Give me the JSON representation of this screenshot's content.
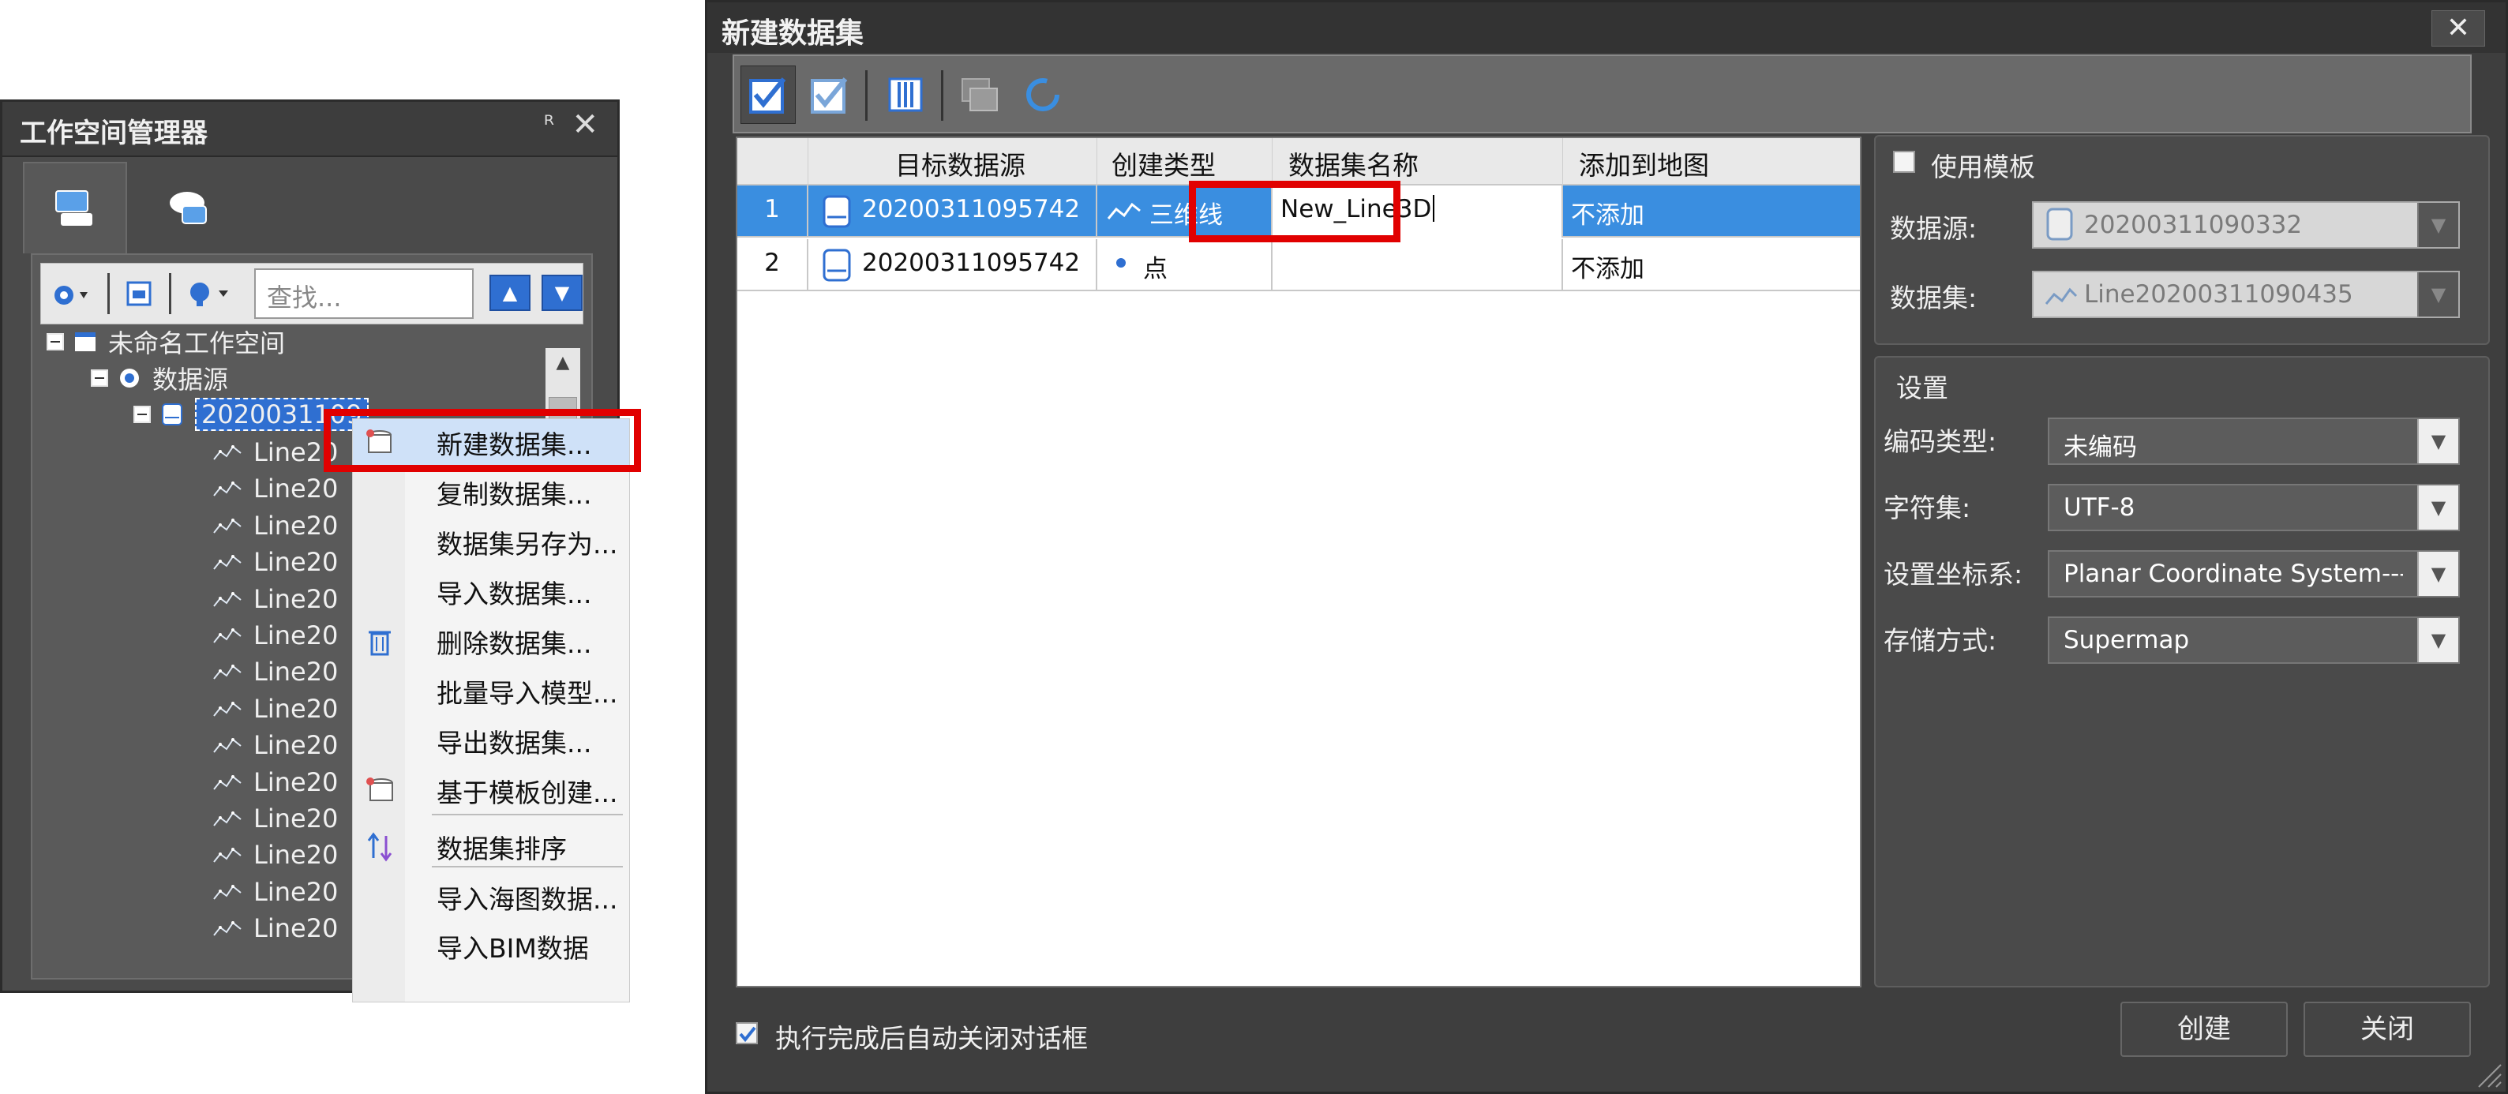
{
  "workspace_panel": {
    "title": "工作空间管理器",
    "pin_glyph": "ᴿ",
    "close_glyph": "✕",
    "search_placeholder": "查找...",
    "tree": {
      "workspace": "未命名工作空间",
      "datasources": "数据源",
      "datasource": "2020031109",
      "datasets": [
        "Line20",
        "Line20",
        "Line20",
        "Line20",
        "Line20",
        "Line20",
        "Line20",
        "Line20",
        "Line20",
        "Line20",
        "Line20",
        "Line20",
        "Line20",
        "Line20"
      ]
    }
  },
  "context_menu": {
    "items": [
      {
        "label": "新建数据集...",
        "icon": "new-dataset-icon",
        "highlighted": true
      },
      {
        "label": "复制数据集...",
        "icon": ""
      },
      {
        "label": "数据集另存为...",
        "icon": ""
      },
      {
        "label": "导入数据集...",
        "icon": ""
      },
      {
        "label": "删除数据集...",
        "icon": "trash-icon"
      },
      {
        "label": "批量导入模型...",
        "icon": ""
      },
      {
        "label": "导出数据集...",
        "icon": ""
      },
      {
        "label": "基于模板创建...",
        "icon": "template-dataset-icon"
      },
      {
        "label": "数据集排序",
        "icon": "sort-icon"
      },
      {
        "label": "导入海图数据...",
        "icon": ""
      },
      {
        "label": "导入BIM数据",
        "icon": ""
      }
    ]
  },
  "dialog": {
    "title": "新建数据集",
    "close_glyph": "✕",
    "table": {
      "columns": [
        "目标数据源",
        "创建类型",
        "数据集名称",
        "添加到地图"
      ],
      "rows": [
        {
          "index": "1",
          "datasource": "20200311095742",
          "type": "三维线",
          "name": "New_Line3D",
          "add_to_map": "不添加"
        },
        {
          "index": "2",
          "datasource": "20200311095742",
          "type": "点",
          "name": "",
          "add_to_map": "不添加"
        }
      ]
    },
    "template": {
      "use_template_label": "使用模板",
      "datasource_label": "数据源:",
      "datasource_value": "20200311090332",
      "dataset_label": "数据集:",
      "dataset_value": "Line20200311090435"
    },
    "settings": {
      "group_label": "设置",
      "encoding_label": "编码类型:",
      "encoding_value": "未编码",
      "charset_label": "字符集:",
      "charset_value": "UTF-8",
      "coord_label": "设置坐标系:",
      "coord_value": "Planar Coordinate System---m",
      "storage_label": "存储方式:",
      "storage_value": "Supermap"
    },
    "auto_close_label": "执行完成后自动关闭对话框",
    "create_button": "创建",
    "close_button": "关闭"
  },
  "colors": {
    "highlight_red": "#e10000",
    "selection_blue": "#3a8ee0",
    "dark_bg": "#3e3e3e"
  }
}
